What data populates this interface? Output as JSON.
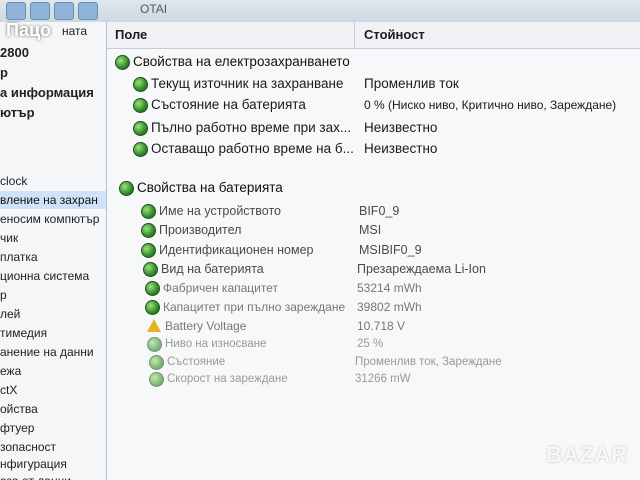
{
  "brand": "Пацо",
  "watermark": "BAZAR",
  "toolbar": {
    "title": "OTAI"
  },
  "columns": {
    "field": "Поле",
    "value": "Стойност"
  },
  "tree": [
    "ната",
    "2800",
    "р",
    "а информация",
    "ютър",
    "clock",
    "вление на захран",
    "еносим компютър",
    "чик",
    "платка",
    "ционна система",
    "р",
    "лей",
    "тимедия",
    "анение на данни",
    "ежа",
    "ctX",
    "ойства",
    "фтуер",
    "зопасност",
    "нфигурация",
    "аза от данни"
  ],
  "power_section": {
    "title": "Свойства на електрозахранването",
    "rows": [
      {
        "field": "Текущ източник на захранване",
        "value": "Променлив ток"
      },
      {
        "field": "Състояние на батерията",
        "value": "0 % (Ниско ниво, Критично ниво, Зареждане)"
      },
      {
        "field": "Пълно работно време при зах...",
        "value": "Неизвестно"
      },
      {
        "field": "Оставащо работно време на б...",
        "value": "Неизвестно"
      }
    ]
  },
  "battery_section": {
    "title": "Свойства на батерията",
    "rows": [
      {
        "field": "Име на устройството",
        "value": "BIF0_9"
      },
      {
        "field": "Производител",
        "value": "MSI"
      },
      {
        "field": "Идентификационен номер",
        "value": "MSIBIF0_9"
      },
      {
        "field": "Вид на батерията",
        "value": "Презареждаема Li-Ion"
      },
      {
        "field": "Фабричен капацитет",
        "value": "53214 mWh"
      },
      {
        "field": "Капацитет при пълно зареждане",
        "value": "39802 mWh"
      },
      {
        "field": "Battery Voltage",
        "value": "10.718 V",
        "icon": "warning-icon"
      },
      {
        "field": "Ниво на износване",
        "value": "25 %"
      },
      {
        "field": "Състояние",
        "value": "Променлив ток, Зареждане"
      },
      {
        "field": "Скорост на зареждане",
        "value": "31266 mW"
      }
    ]
  }
}
